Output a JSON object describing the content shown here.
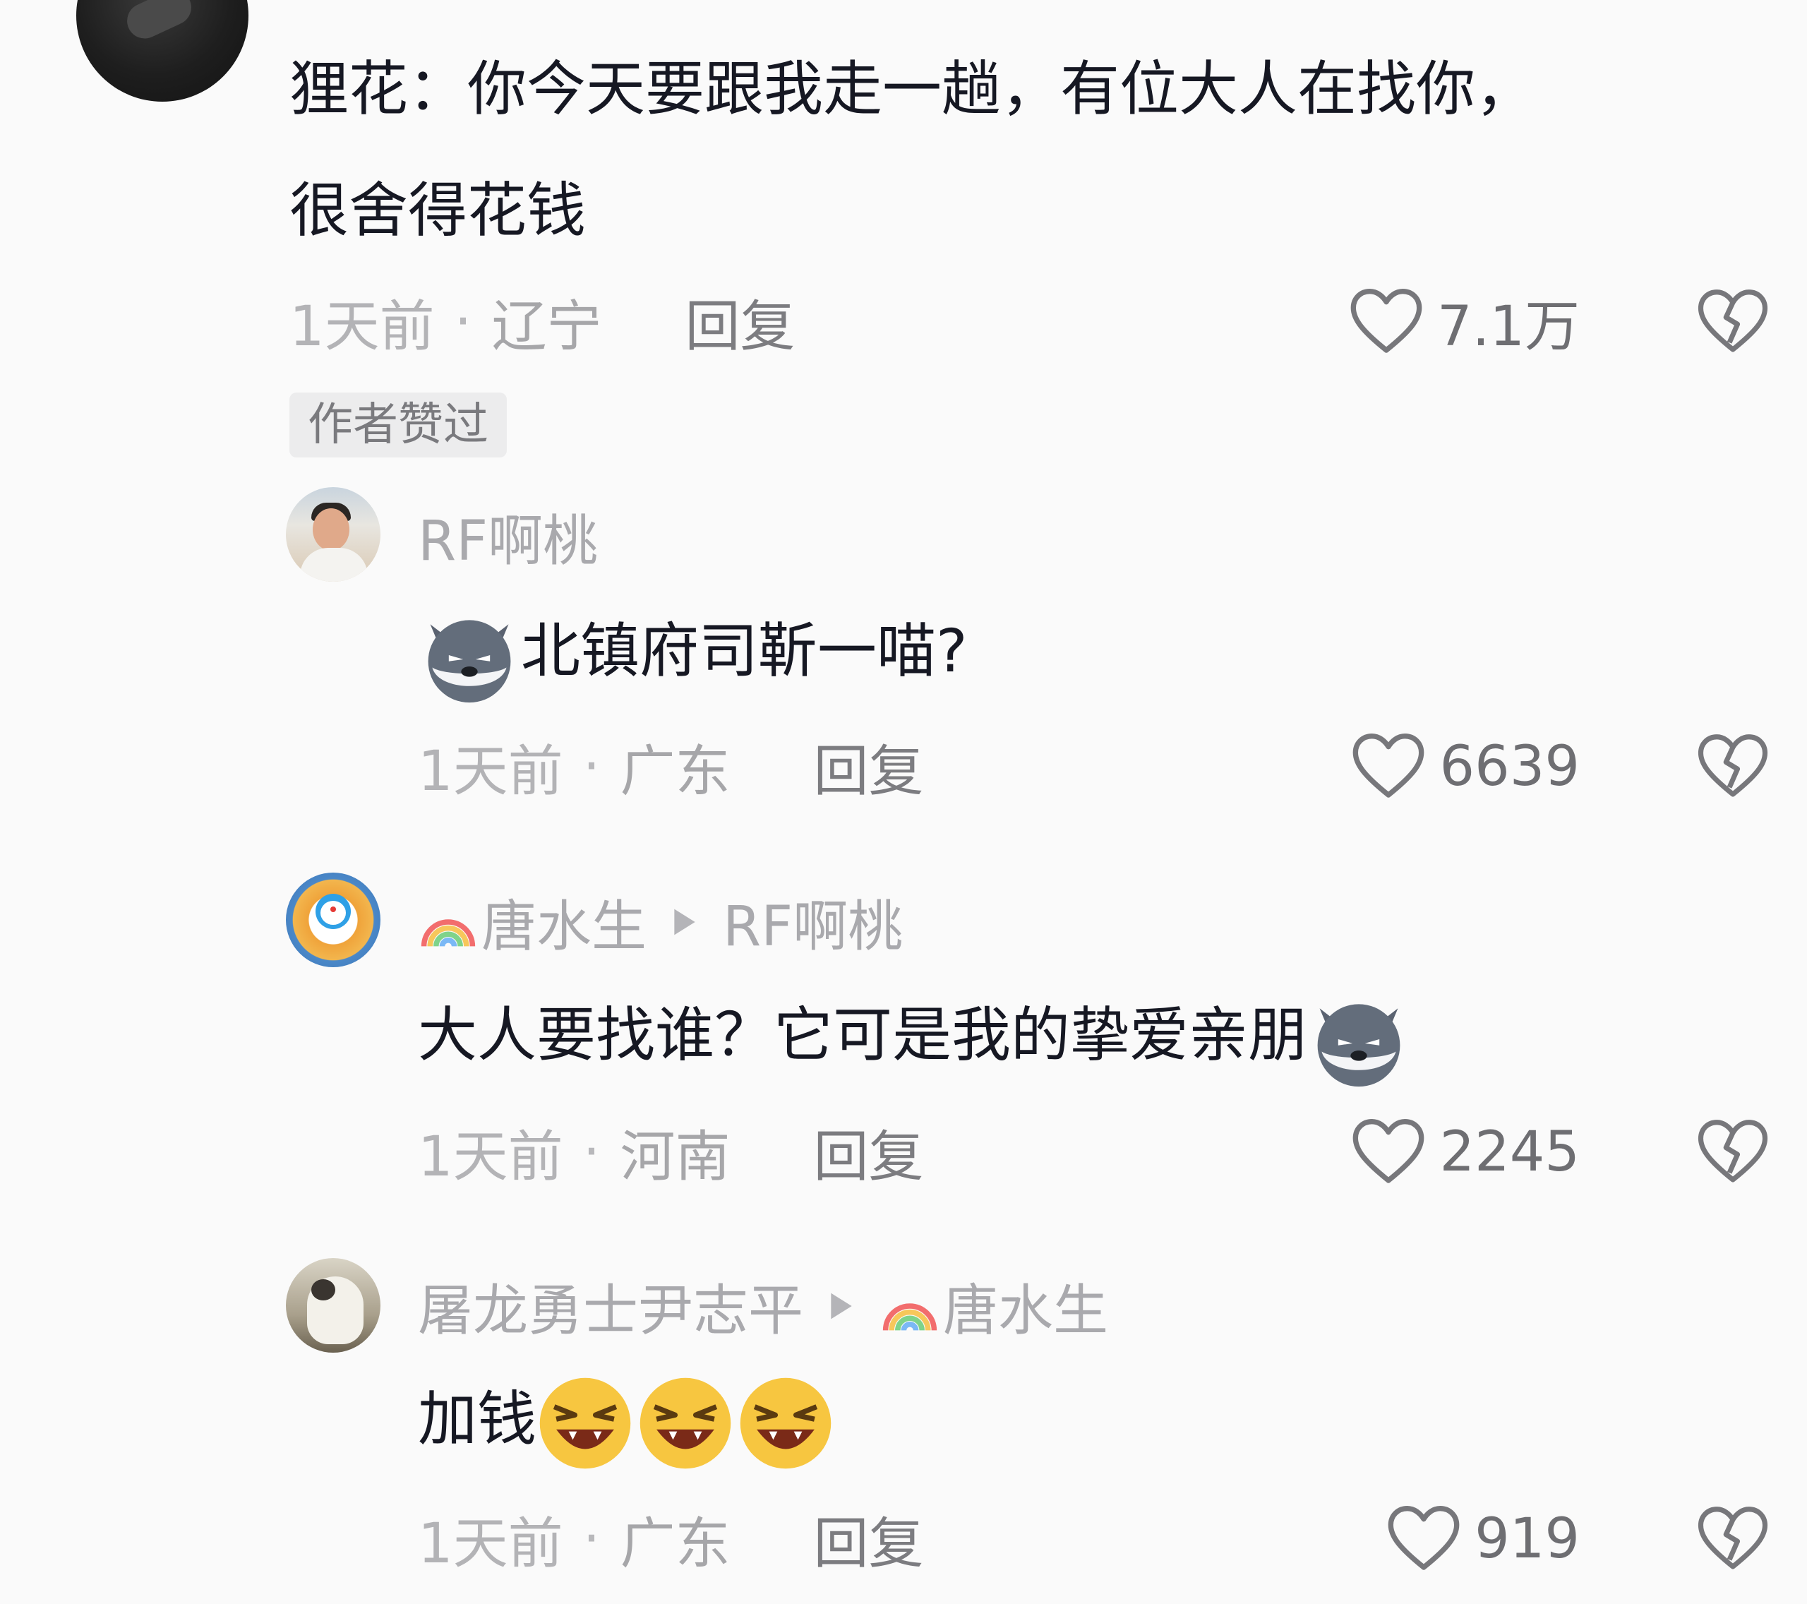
{
  "comments": [
    {
      "text_line1": "狸花：你今天要跟我走一趟，有位大人在找你，",
      "text_line2": "很舍得花钱",
      "time": "1天前",
      "location": "辽宁",
      "reply_label": "回复",
      "likes": "7.1万",
      "badge": "作者赞过"
    }
  ],
  "replies": [
    {
      "author": "RF啊桃",
      "text": "北镇府司靳一喵?",
      "emoji": "husky-emoji",
      "time": "1天前",
      "location": "广东",
      "reply_label": "回复",
      "likes": "6639"
    },
    {
      "author": "唐水生",
      "reply_to": "RF啊桃",
      "text": "大人要找谁？它可是我的挚爱亲朋",
      "emoji": "husky-emoji",
      "time": "1天前",
      "location": "河南",
      "reply_label": "回复",
      "likes": "2245"
    },
    {
      "author": "屠龙勇士尹志平",
      "reply_to": "唐水生",
      "text": "加钱",
      "emoji": "laughing-emoji",
      "time": "1天前",
      "location": "广东",
      "reply_label": "回复",
      "likes": "919"
    }
  ],
  "meta_separator": "·",
  "colors": {
    "background": "#fafafa",
    "text": "#161823",
    "muted": "#a9a9ad",
    "icon": "#6e6e72"
  }
}
